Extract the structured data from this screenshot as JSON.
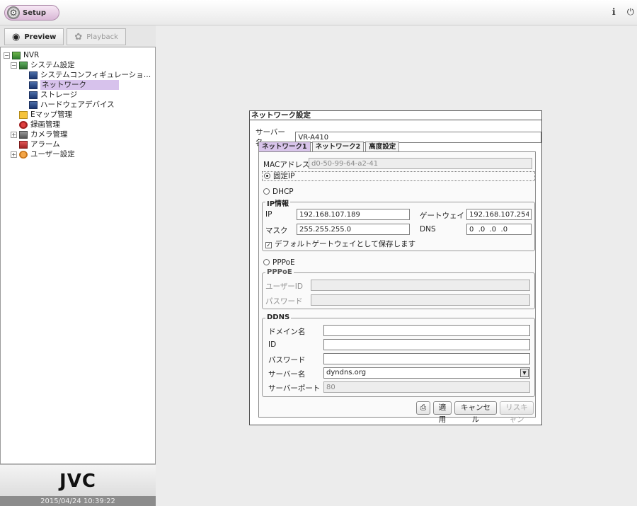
{
  "top": {
    "setup_label": "Setup",
    "icons": [
      "info-icon",
      "power-icon"
    ]
  },
  "modes": {
    "preview": "Preview",
    "playback": "Playback"
  },
  "tree": {
    "nvr": "NVR",
    "system": "システム設定",
    "sysconfig": "システムコンフィギュレーショ…",
    "network": "ネットワーク",
    "storage": "ストレージ",
    "hardware": "ハードウェアデバイス",
    "emap": "Eマップ管理",
    "record": "録画管理",
    "camera": "カメラ管理",
    "alarm": "アラーム",
    "user": "ユーザー設定"
  },
  "footer": {
    "logo": "JVC",
    "datetime": "2015/04/24 10:39:22"
  },
  "dialog": {
    "title": "ネットワーク設定",
    "server_label": "サーバー名",
    "server_value": "VR-A410",
    "tabs": [
      "ネットワーク1",
      "ネットワーク2",
      "高度設定"
    ],
    "mac_label": "MACアドレス",
    "mac_value": "d0-50-99-64-a2-41",
    "fixed_ip": "固定IP",
    "dhcp": "DHCP",
    "ipinfo": {
      "title": "IP情報",
      "ip_label": "IP",
      "ip_value": "192.168.107.189",
      "gw_label": "ゲートウェイ",
      "gw_value": "192.168.107.254",
      "mask_label": "マスク",
      "mask_value": "255.255.255.0",
      "dns_label": "DNS",
      "dns_value": "0  .0  .0  .0",
      "save_gw": "デフォルトゲートウェイとして保存します"
    },
    "pppoe_radio": "PPPoE",
    "pppoe": {
      "title": "PPPoE",
      "userid_label": "ユーザーID",
      "password_label": "パスワード"
    },
    "ddns": {
      "title": "DDNS",
      "domain_label": "ドメイン名",
      "id_label": "ID",
      "password_label": "パスワード",
      "server_label": "サーバー名",
      "server_value": "dyndns.org",
      "port_label": "サーバーポート",
      "port_value": "80"
    },
    "buttons": {
      "apply": "適用",
      "cancel": "キャンセル",
      "rescan": "リスキャン"
    }
  }
}
